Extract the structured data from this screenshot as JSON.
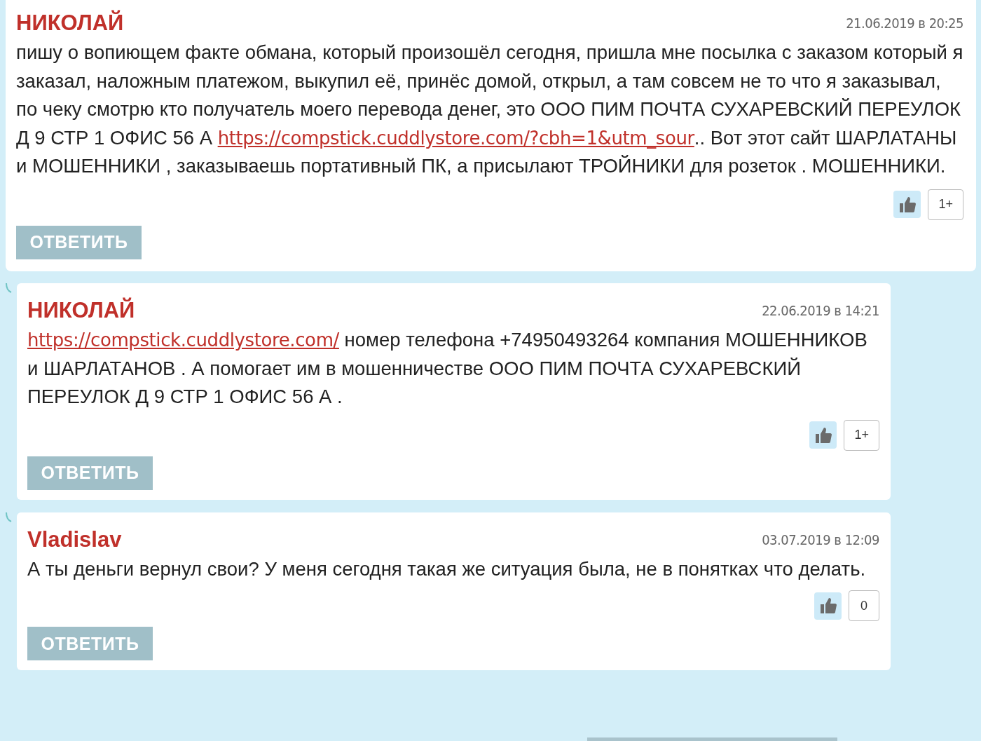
{
  "comments": [
    {
      "author": "НИКОЛАЙ",
      "date": "21.06.2019 в 20:25",
      "nested": false,
      "body": [
        {
          "kind": "text",
          "text": "пишу о вопиющем факте обмана, который произошёл сегодня, пришла мне посылка с заказом который я заказал, наложным платежом, выкупил её, принёс домой, открыл, а там совсем не то что я заказывал, по чеку смотрю кто получатель моего перевода денег, это ООО ПИМ ПОЧТА СУХАРЕВСКИЙ ПЕРЕУЛОК Д 9 СТР 1 ОФИС 56 А "
        },
        {
          "kind": "link",
          "text": "https://compstick.cuddlystore.com/?cbh=1&utm_sour"
        },
        {
          "kind": "text",
          "text": ".. Вот этот сайт ШАРЛАТАНЫ и МОШЕННИКИ , заказываешь портативный ПК, а присылают ТРОЙНИКИ для розеток . МОШЕННИКИ."
        }
      ],
      "likes": "1+",
      "reply": "ОТВЕТИТЬ"
    },
    {
      "author": "НИКОЛАЙ",
      "date": "22.06.2019 в 14:21",
      "nested": true,
      "body": [
        {
          "kind": "link",
          "text": "https://compstick.cuddlystore.com/"
        },
        {
          "kind": "text",
          "text": " номер телефона +74950493264 компания МОШЕННИКОВ и ШАРЛАТАНОВ . А помогает им в мошенничестве ООО ПИМ ПОЧТА СУХАРЕВСКИЙ ПЕРЕУЛОК Д 9 СТР 1 ОФИС 56 А ."
        }
      ],
      "likes": "1+",
      "reply": "ОТВЕТИТЬ"
    },
    {
      "author": "Vladislav",
      "date": "03.07.2019 в 12:09",
      "nested": true,
      "body": [
        {
          "kind": "text",
          "text": "А ты деньги вернул свои? У меня сегодня такая же ситуация была, не в понятках что делать."
        }
      ],
      "likes": "0",
      "reply": "ОТВЕТИТЬ"
    }
  ]
}
